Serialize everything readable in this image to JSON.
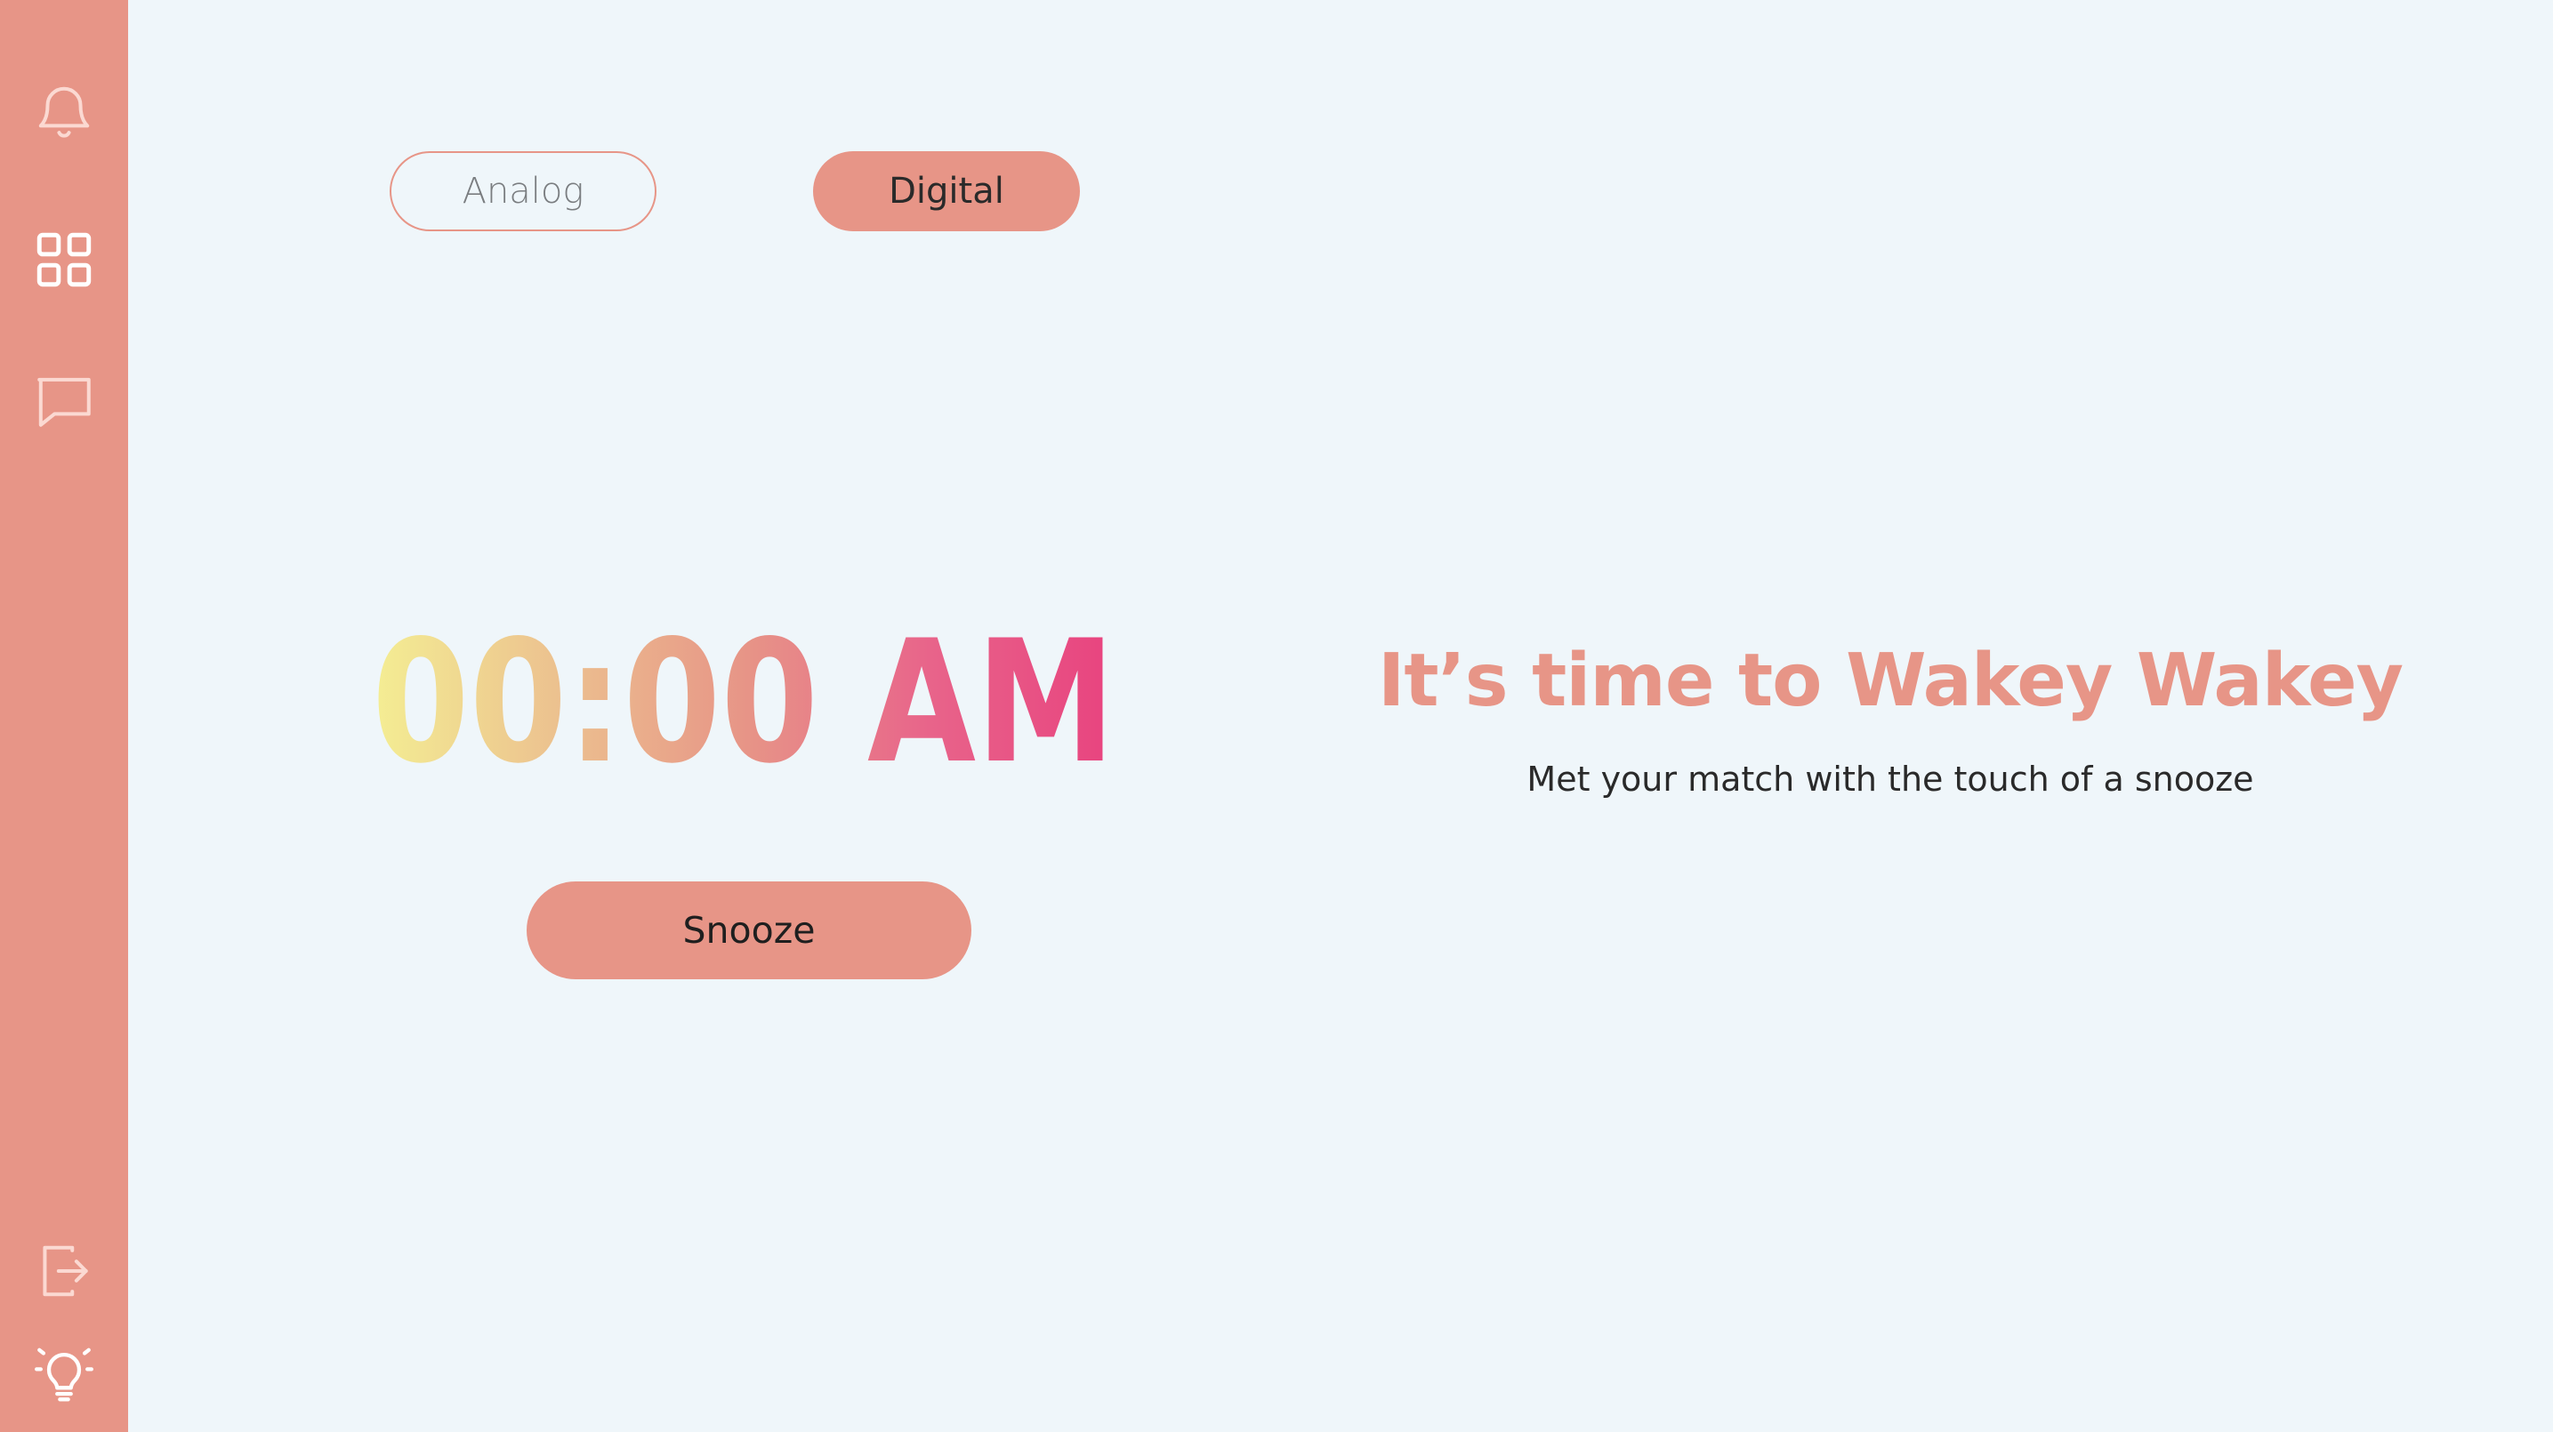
{
  "sidebar": {
    "icons": [
      "bell-icon",
      "grid-icon",
      "chat-icon",
      "logout-icon",
      "lightbulb-icon"
    ]
  },
  "mode_toggle": {
    "analog_label": "Analog",
    "digital_label": "Digital",
    "active": "Digital"
  },
  "clock": {
    "time": "00:00 AM",
    "gradient": [
      "#f4ee93",
      "#ecc18f",
      "#e79587",
      "#e8648a",
      "#e8437f"
    ]
  },
  "snooze": {
    "label": "Snooze"
  },
  "message": {
    "headline": "It’s time to Wakey Wakey",
    "subline": "Met your match with the touch of a snooze"
  },
  "colors": {
    "accent": "#e79587",
    "background": "#eff6fa",
    "sidebar": "#e79587",
    "icon": "#fbd9d2"
  }
}
